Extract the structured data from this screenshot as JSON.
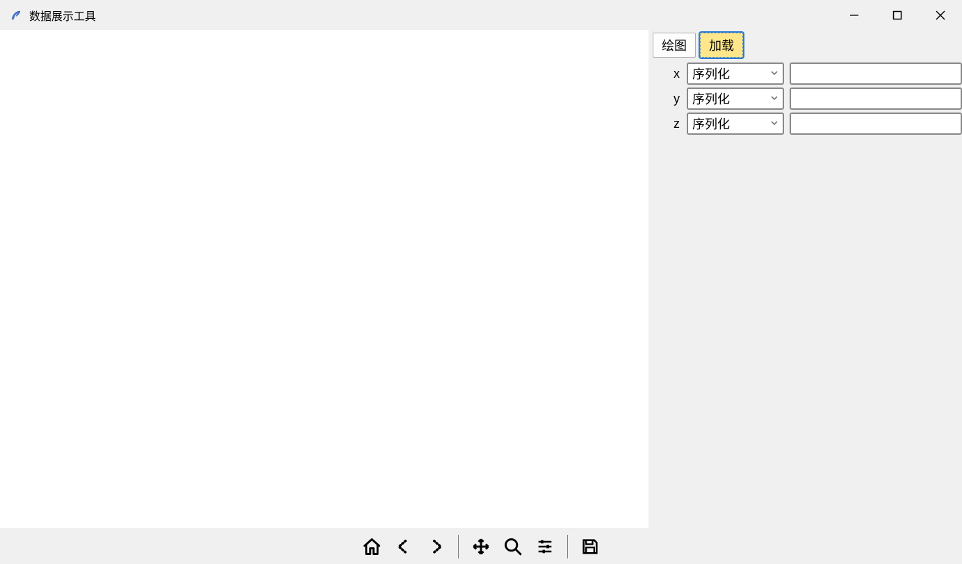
{
  "window": {
    "title": "数据展示工具"
  },
  "buttons": {
    "plot": "绘图",
    "load": "加载"
  },
  "rows": [
    {
      "label": "x",
      "combo": "序列化",
      "value": ""
    },
    {
      "label": "y",
      "combo": "序列化",
      "value": ""
    },
    {
      "label": "z",
      "combo": "序列化",
      "value": ""
    }
  ],
  "toolbar": {
    "home": "home",
    "back": "back",
    "forward": "forward",
    "pan": "pan",
    "zoom": "zoom",
    "configure": "configure",
    "save": "save"
  }
}
